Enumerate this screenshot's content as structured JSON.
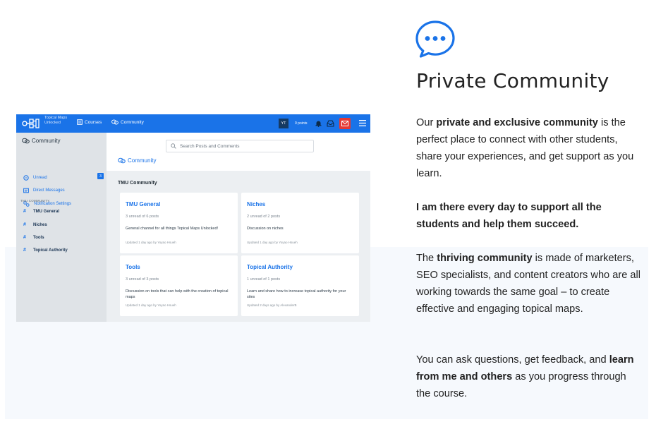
{
  "screenshot": {
    "logo_text": "Topical Maps Unlocked",
    "nav": {
      "courses": "Courses",
      "community": "Community"
    },
    "user_initials": "YT",
    "points": "0 points",
    "search_placeholder": "Search Posts and Comments",
    "page_title": "Community",
    "sidebar": {
      "title": "Community",
      "items": [
        {
          "label": "Unread",
          "badge": "3"
        },
        {
          "label": "Direct Messages"
        },
        {
          "label": "Notification Settings"
        }
      ],
      "section_label": "TMU COMMUNITY",
      "channels": [
        "TMU General",
        "Niches",
        "Tools",
        "Topical Authority"
      ]
    },
    "section_title": "TMU Community",
    "cards": [
      {
        "title": "TMU General",
        "meta": "3 unread of 6 posts",
        "desc": "General channel for all things Topical Maps Unlocked!",
        "updated": "Updated 1 day ago by Yoyao Hsueh"
      },
      {
        "title": "Niches",
        "meta": "2 unread of 2 posts",
        "desc": "Discussion on niches",
        "updated": "Updated 1 day ago by Yoyao Hsueh"
      },
      {
        "title": "Tools",
        "meta": "3 unread of 3 posts",
        "desc": "Discussion on tools that can help with the creation of topical maps",
        "updated": "Updated 1 day ago by Yoyao Hsueh"
      },
      {
        "title": "Topical Authority",
        "meta": "1 unread of 1 posts",
        "desc": "Learn and share how to increase topical authority for your sites",
        "updated": "Updated 2 days ago by AlexanderB"
      }
    ]
  },
  "content": {
    "heading": "Private Community",
    "p1": {
      "t1": "Our ",
      "b1": "private and exclusive community",
      "t2": " is the perfect place to connect with other students, share your experiences, and get support as you learn."
    },
    "p2": {
      "b1": "I am there every day to support all the students and help them succeed."
    },
    "p3": {
      "t1": "The ",
      "b1": "thriving community",
      "t2": " is made of marketers, SEO specialists, and content creators who are all working towards the same goal – to create effective and engaging topical maps."
    },
    "p4": {
      "t1": "You can ask questions, get feedback, and ",
      "b1": "learn from me and others",
      "t2": " as you progress through the course."
    }
  },
  "colors": {
    "accent": "#1a73e8",
    "mail_badge": "#e53935",
    "sidebar_bg": "#dfe3e7",
    "panel_bg": "#f6f9fd"
  },
  "icons": [
    "chat-bubble-icon",
    "logo-icon",
    "courses-icon",
    "community-icon",
    "bell-icon",
    "inbox-icon",
    "mail-icon",
    "menu-icon",
    "search-icon",
    "unread-icon",
    "direct-messages-icon",
    "notification-settings-icon",
    "hash-icon"
  ]
}
